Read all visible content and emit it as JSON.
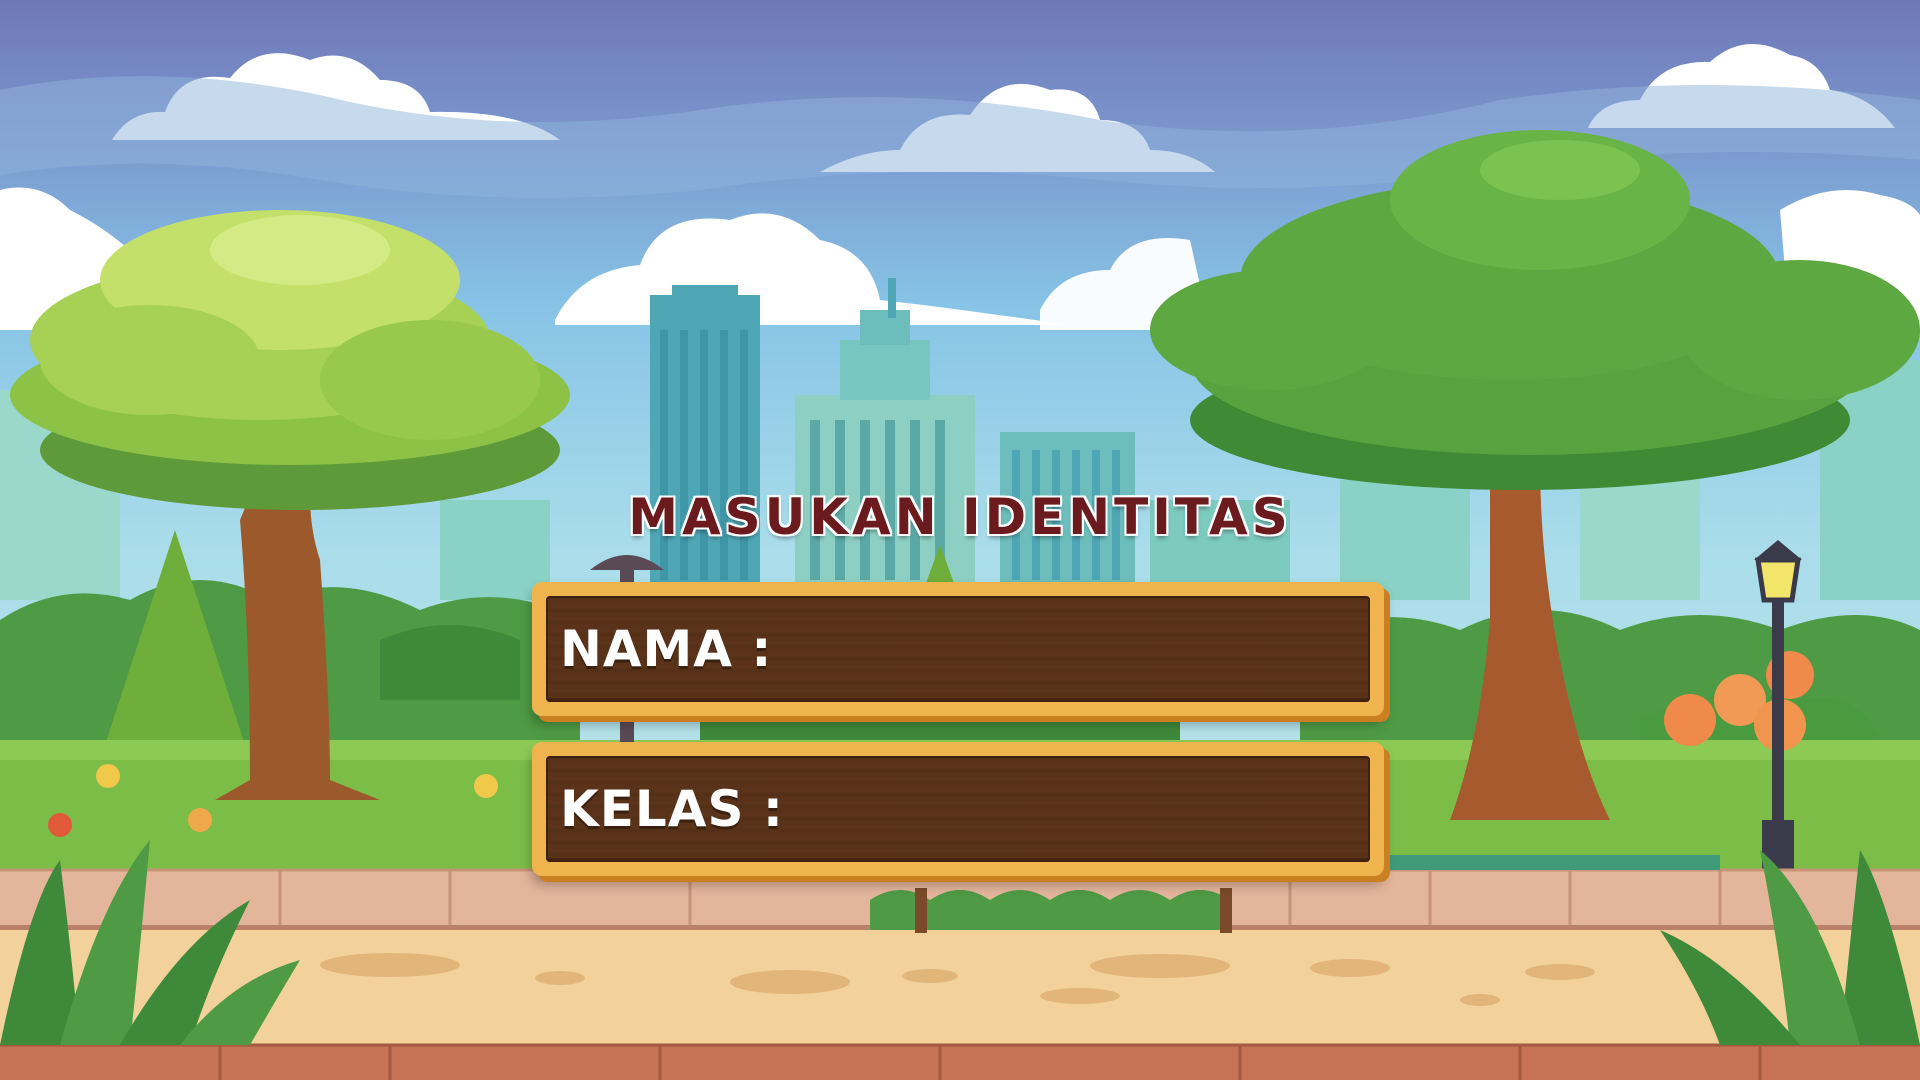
{
  "title": "MASUKAN IDENTITAS",
  "form": {
    "nama_label": "NAMA :",
    "nama_value": "",
    "kelas_label": "KELAS :",
    "kelas_value": ""
  },
  "colors": {
    "sky_top": "#6f78b8",
    "sky_mid": "#7fb6de",
    "title_text": "#6b1a1d",
    "panel_frame": "#f0b44f",
    "panel_wood": "#5a3219",
    "label_text": "#ffffff"
  }
}
